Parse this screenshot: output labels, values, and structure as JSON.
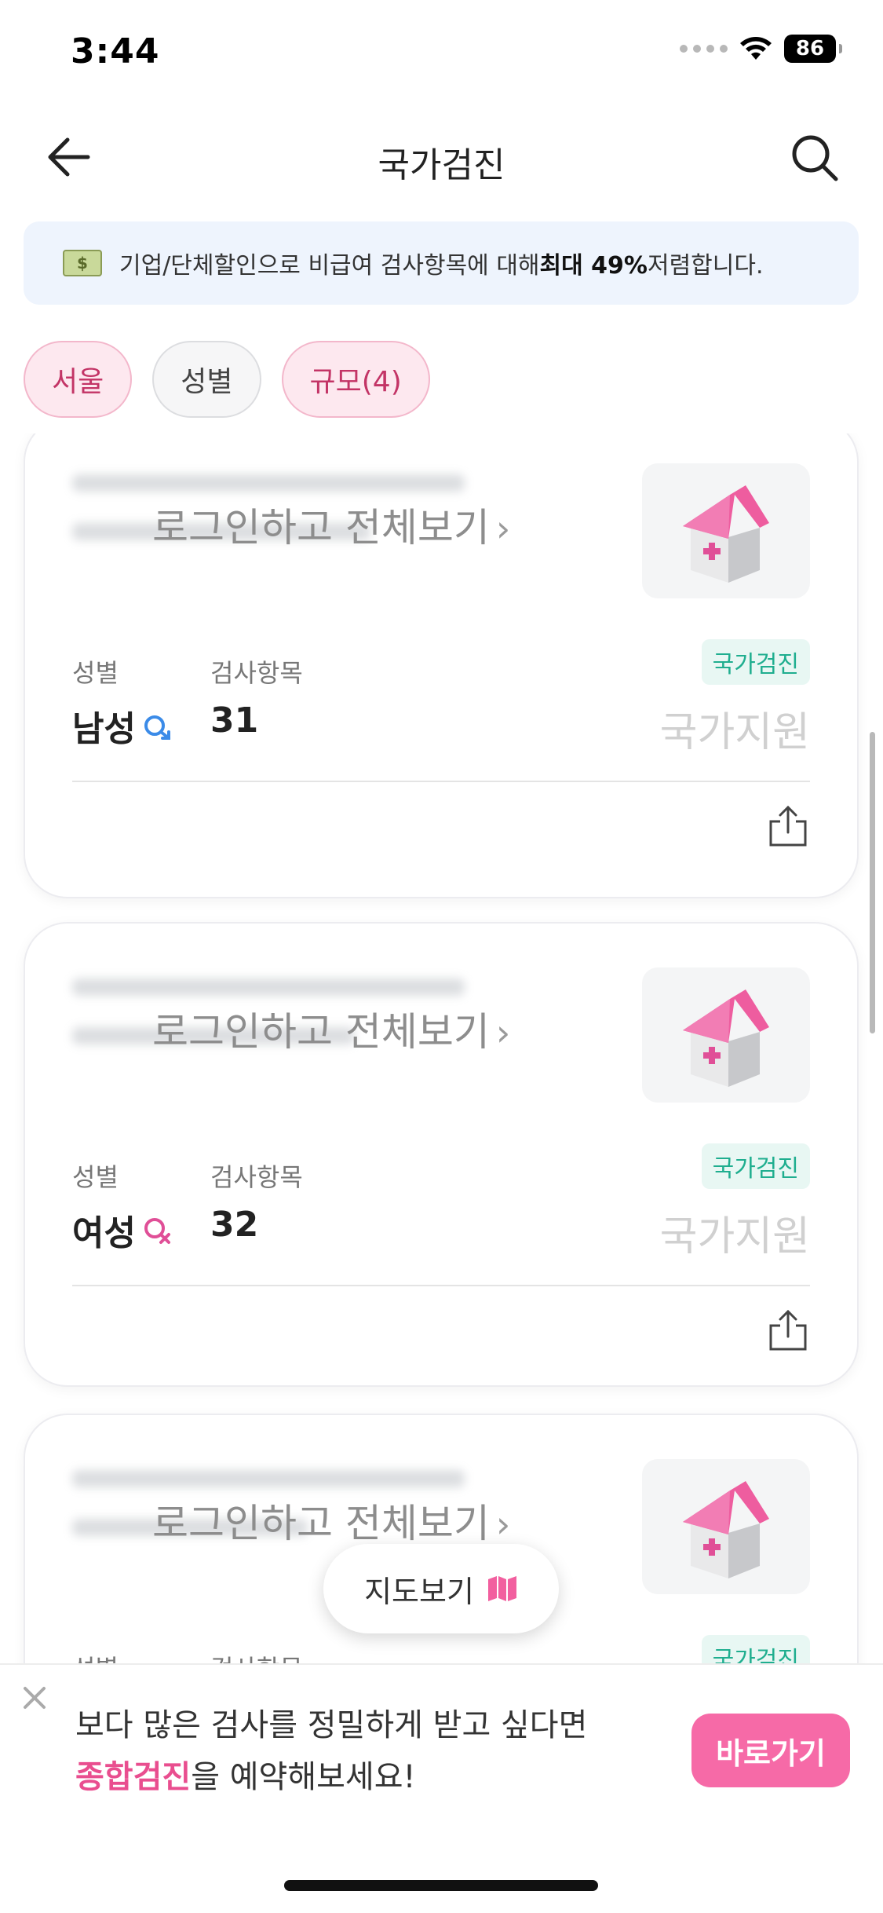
{
  "status": {
    "time": "3:44",
    "battery": "86"
  },
  "header": {
    "title": "국가검진"
  },
  "promo": {
    "text_before": "기업/단체할인으로 비급여 검사항목에 대해 ",
    "text_bold": "최대 49%",
    "text_after": " 저렴합니다."
  },
  "filters": [
    {
      "label": "서울"
    },
    {
      "label": "성별"
    },
    {
      "label": "규모(4)"
    }
  ],
  "cards": [
    {
      "login_link": "로그인하고 전체보기",
      "gender_label": "성별",
      "gender_value": "남성",
      "items_label": "검사항목",
      "items_value": "31",
      "tag": "국가검진",
      "support": "국가지원"
    },
    {
      "login_link": "로그인하고 전체보기",
      "gender_label": "성별",
      "gender_value": "여성",
      "items_label": "검사항목",
      "items_value": "32",
      "tag": "국가검진",
      "support": "국가지원"
    },
    {
      "login_link": "로그인하고 전체보기",
      "gender_label": "성별",
      "gender_value": "",
      "items_label": "검사항목",
      "items_value": "",
      "tag": "국가검진",
      "support": ""
    }
  ],
  "map_button": {
    "label": "지도보기"
  },
  "bottom_sheet": {
    "line1": "보다 많은 검사를 정밀하게 받고 싶다면",
    "line2_highlight": "종합검진",
    "line2_rest": "을 예약해보세요!",
    "button": "바로가기"
  },
  "colors": {
    "accent_pink": "#f66aa7",
    "tag_green": "#1fae8f",
    "male_blue": "#3b8be8",
    "female_pink": "#e04f97"
  }
}
